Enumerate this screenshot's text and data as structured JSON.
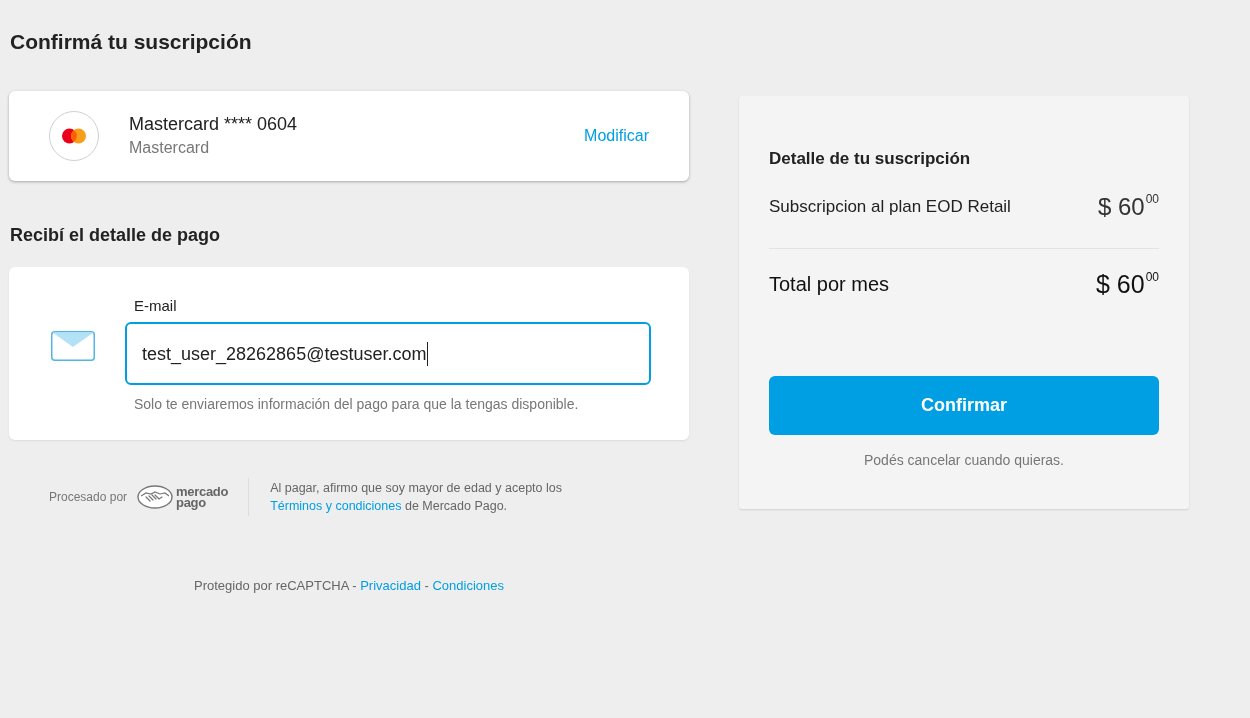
{
  "page": {
    "title": "Confirmá tu suscripción"
  },
  "payment_method": {
    "card_line": "Mastercard **** 0604",
    "brand": "Mastercard",
    "action": "Modificar"
  },
  "receipt": {
    "heading": "Recibí el detalle de pago",
    "email_field": {
      "label": "E-mail",
      "value": "test_user_28262865@testuser.com",
      "focused": true
    },
    "hint": "Solo te enviaremos información del pago para que la tengas disponible."
  },
  "footer": {
    "processor_label": "Procesado por",
    "logo_text": [
      "mercado",
      "pago"
    ],
    "terms": [
      {
        "kind": "text",
        "text": "Al pagar, afirmo que soy mayor de edad y acepto los"
      },
      {
        "kind": "link",
        "text": "Términos y condiciones"
      },
      {
        "kind": "text",
        "text": "de Mercado Pago."
      }
    ]
  },
  "recaptcha": [
    {
      "kind": "text",
      "text": "Protegido por reCAPTCHA -"
    },
    {
      "kind": "link",
      "text": "Privacidad"
    },
    {
      "kind": "text",
      "text": "-"
    },
    {
      "kind": "link",
      "text": "Condiciones"
    }
  ],
  "summary": {
    "heading": "Detalle de tu suscripción",
    "items": [
      {
        "kind": "line",
        "label": "Subscripcion al plan EOD Retail",
        "price": "$ 60$^{00}$"
      },
      {
        "kind": "total",
        "label": "Total por mes",
        "price": "$ 60$^{00}$"
      }
    ],
    "button": "Confirmar",
    "note": "Podés cancelar cuando quieras."
  }
}
